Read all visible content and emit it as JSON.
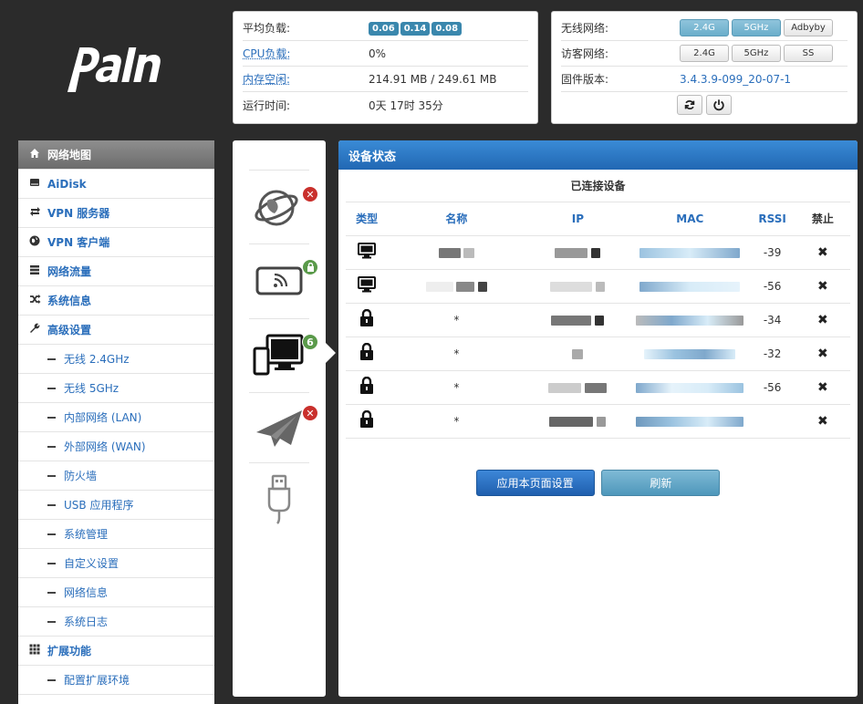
{
  "logo_text": "padavan",
  "system_stats": {
    "load_label": "平均负载:",
    "load_values": [
      "0.06",
      "0.14",
      "0.08"
    ],
    "cpu_label": "CPU负载:",
    "cpu_value": "0%",
    "mem_label": "内存空闲:",
    "mem_value": "214.91 MB / 249.61 MB",
    "uptime_label": "运行时间:",
    "uptime_value": "0天 17时 35分"
  },
  "network_panel": {
    "wireless_label": "无线网络:",
    "wireless_buttons": [
      "2.4G",
      "5GHz",
      "Adbyby"
    ],
    "guest_label": "访客网络:",
    "guest_buttons": [
      "2.4G",
      "5GHz",
      "SS"
    ],
    "firmware_label": "固件版本:",
    "firmware_value": "3.4.3.9-099_20-07-1"
  },
  "sidebar": {
    "items": [
      {
        "label": "网络地图",
        "icon": "home-icon"
      },
      {
        "label": "AiDisk",
        "icon": "disk-icon"
      },
      {
        "label": "VPN 服务器",
        "icon": "retweet-icon"
      },
      {
        "label": "VPN 客户端",
        "icon": "globe-icon"
      },
      {
        "label": "网络流量",
        "icon": "tasks-icon"
      },
      {
        "label": "系统信息",
        "icon": "random-icon"
      },
      {
        "label": "高级设置",
        "icon": "wrench-icon"
      }
    ],
    "sub_items": [
      "无线 2.4GHz",
      "无线 5GHz",
      "内部网络 (LAN)",
      "外部网络 (WAN)",
      "防火墙",
      "USB 应用程序",
      "系统管理",
      "自定义设置",
      "网络信息",
      "系统日志"
    ],
    "ext_label": "扩展功能",
    "ext_sub": "配置扩展环境"
  },
  "device_panel_badges": {
    "lock_badge": "",
    "client_count": "6"
  },
  "main": {
    "header": "设备状态",
    "section_title": "已连接设备",
    "columns": [
      "类型",
      "名称",
      "IP",
      "MAC",
      "RSSI",
      "禁止"
    ],
    "rows": [
      {
        "type": "desktop-icon",
        "name": "",
        "rssi": "-39"
      },
      {
        "type": "desktop-icon",
        "name": "",
        "rssi": "-56"
      },
      {
        "type": "lock-icon",
        "name": "*",
        "rssi": "-34"
      },
      {
        "type": "lock-icon",
        "name": "*",
        "rssi": "-32"
      },
      {
        "type": "lock-icon",
        "name": "*",
        "rssi": "-56"
      },
      {
        "type": "lock-icon",
        "name": "*",
        "rssi": ""
      }
    ],
    "ban_mark": "✖",
    "apply_button": "应用本页面设置",
    "refresh_button": "刷新"
  }
}
